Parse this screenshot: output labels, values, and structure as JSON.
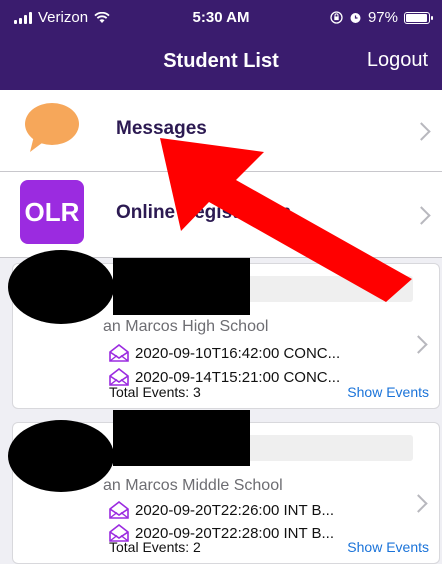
{
  "status": {
    "carrier": "Verizon",
    "time": "5:30 AM",
    "battery": "97%",
    "battery_level": 0.97
  },
  "nav": {
    "title": "Student List",
    "logout": "Logout"
  },
  "menu": [
    {
      "label": "Messages",
      "icon": "speech-bubble-icon"
    },
    {
      "label": "Online Registration",
      "icon_text": "OLR"
    }
  ],
  "students": [
    {
      "school": "an Marcos High School",
      "events": [
        "2020-09-10T16:42:00 CONC...",
        "2020-09-14T15:21:00 CONC..."
      ],
      "total": "Total Events: 3",
      "show_events": "Show Events"
    },
    {
      "school": "an Marcos Middle School",
      "events": [
        "2020-09-20T22:26:00 INT B...",
        "2020-09-20T22:28:00 INT B..."
      ],
      "total": "Total Events: 2",
      "show_events": "Show Events"
    }
  ],
  "colors": {
    "header": "#3a1c6e",
    "olr": "#9b2be0",
    "envelope": "#9b2be0",
    "link": "#1a73d9",
    "arrow": "#ff0000"
  }
}
